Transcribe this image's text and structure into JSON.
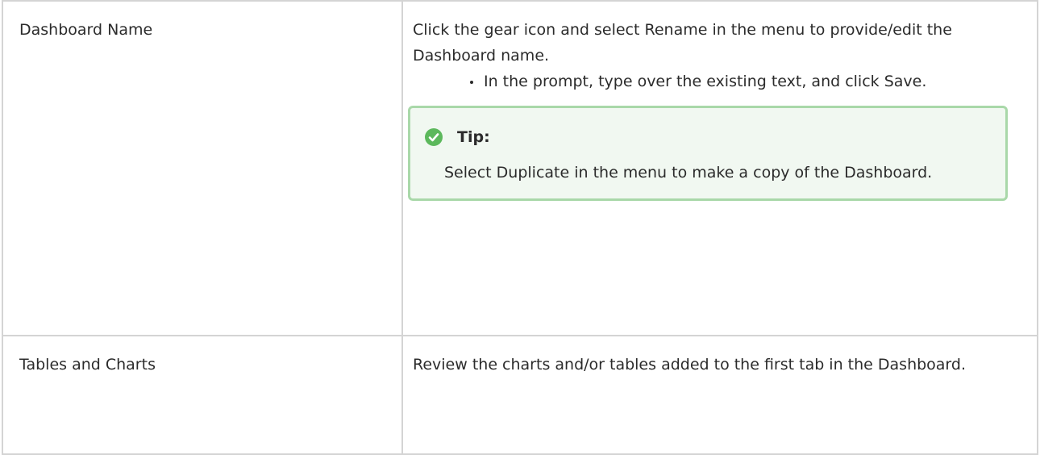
{
  "rows": [
    {
      "label": "Dashboard Name",
      "description": "Click the gear icon and select Rename in the menu to provide/edit the Dashboard name.",
      "bullets": [
        "In the prompt, type over the existing text, and click Save."
      ],
      "tip": {
        "icon": "check-circle-icon",
        "title": "Tip:",
        "text": "Select Duplicate in the menu to make a copy of the Dashboard."
      }
    },
    {
      "label": "Tables and Charts",
      "description": "Review the charts and/or tables added to the first tab in the Dashboard."
    }
  ],
  "colors": {
    "border": "#d4d4d4",
    "tip_border": "#a9d8a9",
    "tip_background": "#f1f8f1",
    "tip_icon": "#5cb85c",
    "text": "#2b2b2b"
  }
}
